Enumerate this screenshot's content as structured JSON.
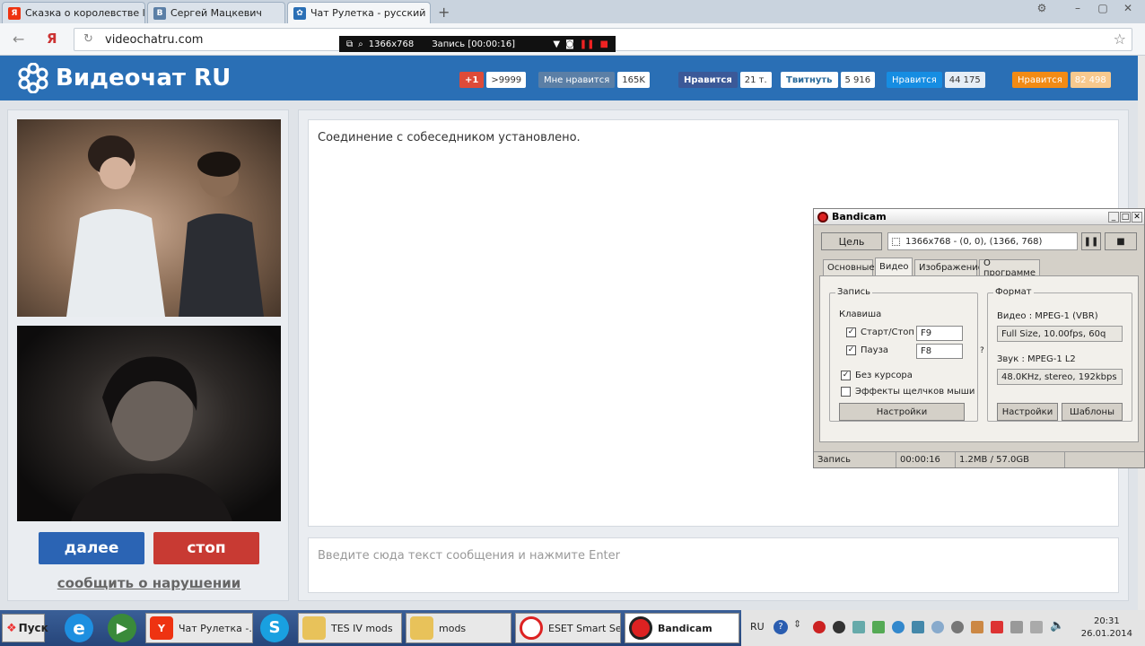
{
  "browser": {
    "tabs": [
      {
        "label": "Сказка о королевстве l",
        "icon": "yandex-icon"
      },
      {
        "label": "Сергей Мацкевич",
        "icon": "vk-icon"
      },
      {
        "label": "Чат Рулетка - русский",
        "icon": "videochat-icon"
      }
    ],
    "url": "videochatru.com",
    "yandex_letter": "Я"
  },
  "recording_bar": {
    "resolution": "1366x768",
    "status": "Запись [00:00:16]"
  },
  "site": {
    "title": "Видеочат RU",
    "social": [
      {
        "button": "+1",
        "count": ">9999",
        "color": "#dd4b39"
      },
      {
        "button": "Мне нравится",
        "count": "165K",
        "color": "#5b7fa6"
      },
      {
        "button": "Нравится",
        "count": "21 т.",
        "color": "#3b5998"
      },
      {
        "button": "Твитнуть",
        "count": "5 916",
        "color": "#2ca6dd"
      },
      {
        "button": "Нравится",
        "count": "44 175",
        "color": "#168de2"
      },
      {
        "button": "Нравится",
        "count": "82 498",
        "color": "#f28b15"
      }
    ],
    "next_button": "далее",
    "stop_button": "стоп",
    "report_link": "сообщить о нарушении",
    "chat_message": "Соединение с собеседником установлено.",
    "chat_placeholder": "Введите сюда текст сообщения и нажмите Enter"
  },
  "bandicam": {
    "title": "Bandicam",
    "target_button": "Цель",
    "target_info": "1366x768 - (0, 0), (1366, 768)",
    "tabs": [
      "Основные",
      "Видео",
      "Изображение",
      "О программе"
    ],
    "active_tab": "Видео",
    "record_group": "Запись",
    "hotkey_label": "Клавиша",
    "startstop_label": "Старт/Стоп",
    "startstop_key": "F9",
    "pause_label": "Пауза",
    "pause_key": "F8",
    "no_cursor_label": "Без курсора",
    "click_effects_label": "Эффекты щелчков мыши",
    "settings_button": "Настройки",
    "format_group": "Формат",
    "video_label": "Видео : MPEG-1 (VBR)",
    "video_value": "Full Size, 10.00fps, 60q",
    "audio_label": "Звук : MPEG-1 L2",
    "audio_value": "48.0KHz, stereo, 192kbps",
    "format_settings_button": "Настройки",
    "templates_button": "Шаблоны",
    "status": {
      "label": "Запись",
      "time": "00:00:16",
      "size": "1.2MB / 57.0GB"
    }
  },
  "taskbar": {
    "start": "Пуск",
    "items": [
      {
        "label": "Чат Рулетка -...",
        "icon": "yandex-browser-icon"
      },
      {
        "label": "TES IV mods",
        "icon": "folder-icon"
      },
      {
        "label": "mods",
        "icon": "folder-icon"
      },
      {
        "label": "ESET Smart Se...",
        "icon": "eset-icon"
      },
      {
        "label": "Bandicam",
        "icon": "bandicam-icon"
      }
    ],
    "language": "RU",
    "time": "20:31",
    "date": "26.01.2014"
  }
}
